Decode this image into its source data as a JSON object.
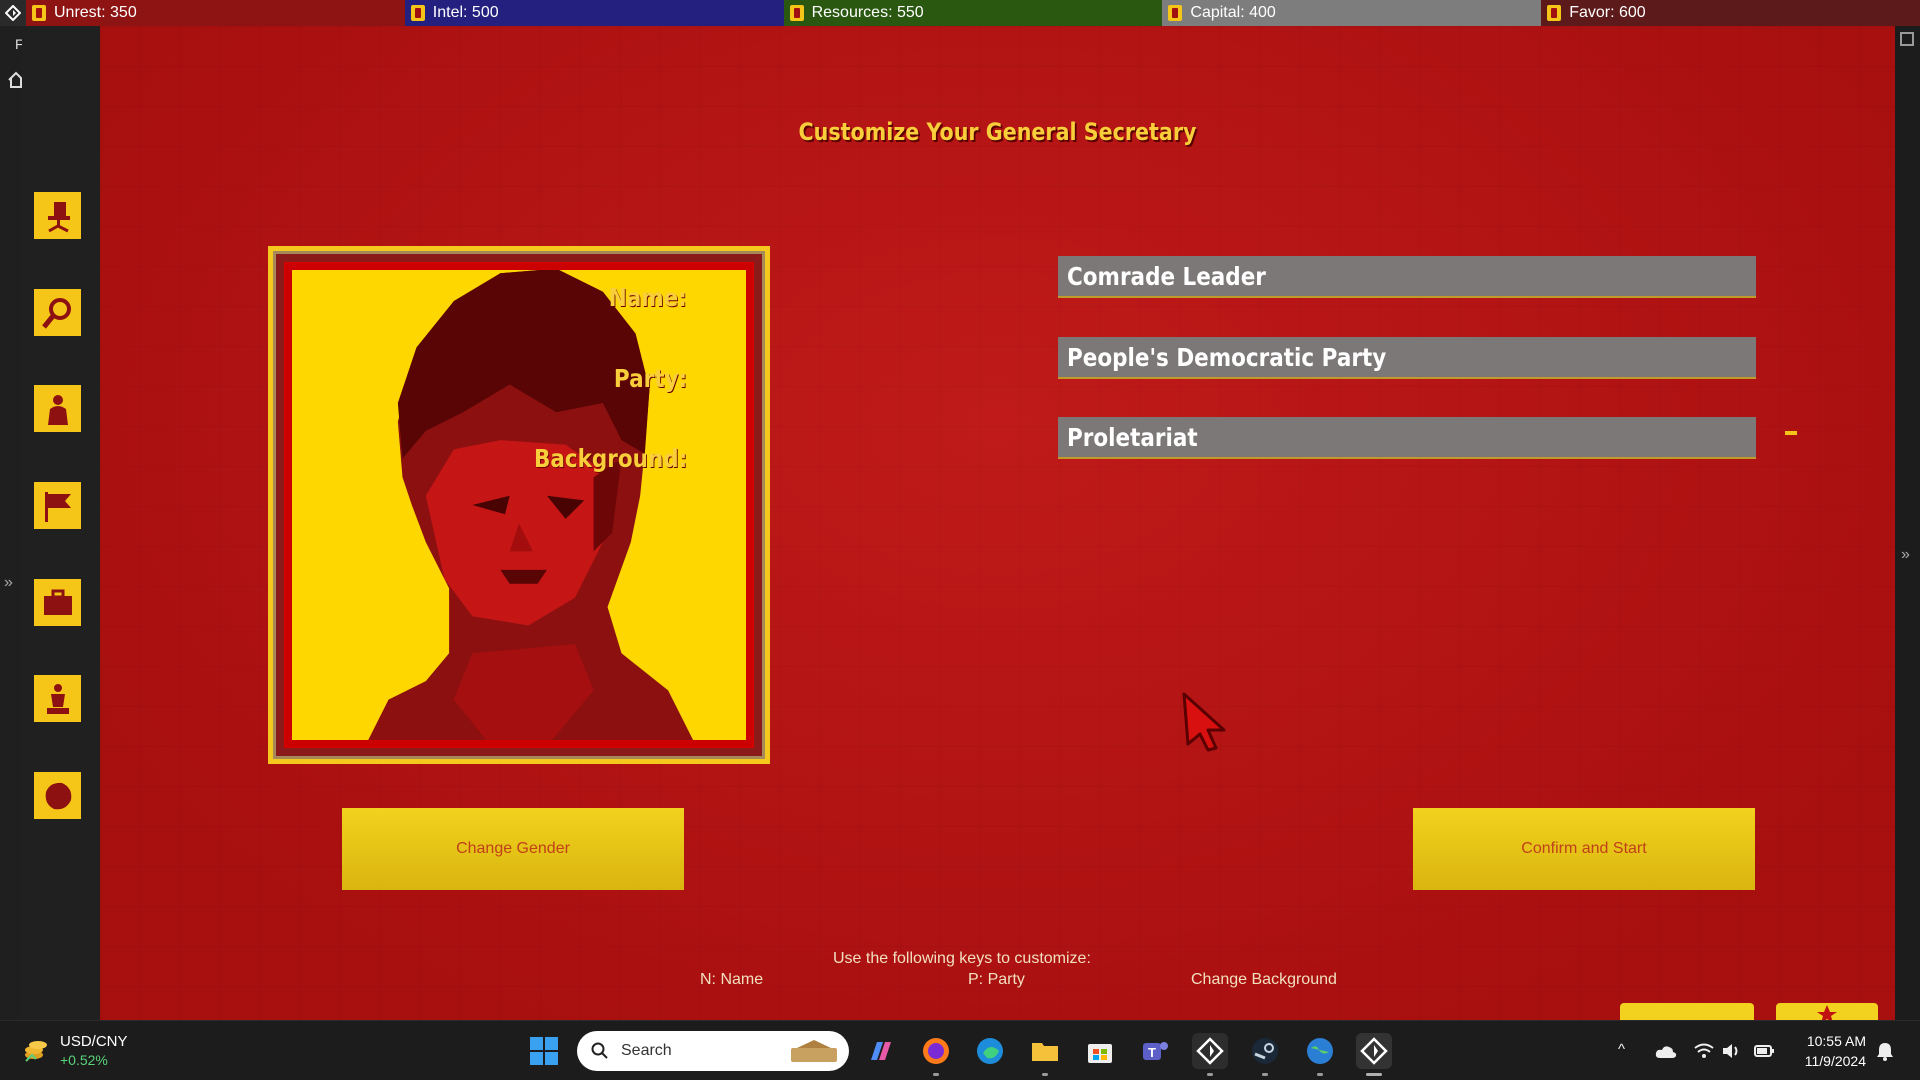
{
  "topbar": {
    "stats": [
      {
        "label": "Unrest: 350",
        "color": "#8e1313"
      },
      {
        "label": "Intel: 500",
        "color": "#232080"
      },
      {
        "label": "Resources: 550",
        "color": "#2b5810"
      },
      {
        "label": "Capital: 400",
        "color": "#7d7d7d"
      },
      {
        "label": "Favor: 600",
        "color": "#5d1a1a"
      }
    ]
  },
  "strip": {
    "letter": "F"
  },
  "sidebar": {
    "buttons": [
      "office-chair-icon",
      "magnifier-icon",
      "person-icon",
      "flag-icon",
      "briefcase-icon",
      "monument-icon",
      "globe-icon"
    ]
  },
  "main": {
    "title": "Customize Your General Secretary",
    "fields": [
      {
        "label": "Name:",
        "value": "Comrade Leader"
      },
      {
        "label": "Party:",
        "value": "People's Democratic Party"
      },
      {
        "label": "Background:",
        "value": "Proletariat"
      }
    ],
    "buttons": {
      "change_gender": "Change Gender",
      "confirm": "Confirm and Start"
    },
    "hints": {
      "intro": "Use the following keys to customize:",
      "name": "N: Name",
      "party": "P: Party",
      "background": "Change Background"
    }
  },
  "taskbar": {
    "ticker": {
      "name": "USD/CNY",
      "change": "+0.52%"
    },
    "search_placeholder": "Search",
    "time": "10:55 AM",
    "date": "11/9/2024"
  }
}
